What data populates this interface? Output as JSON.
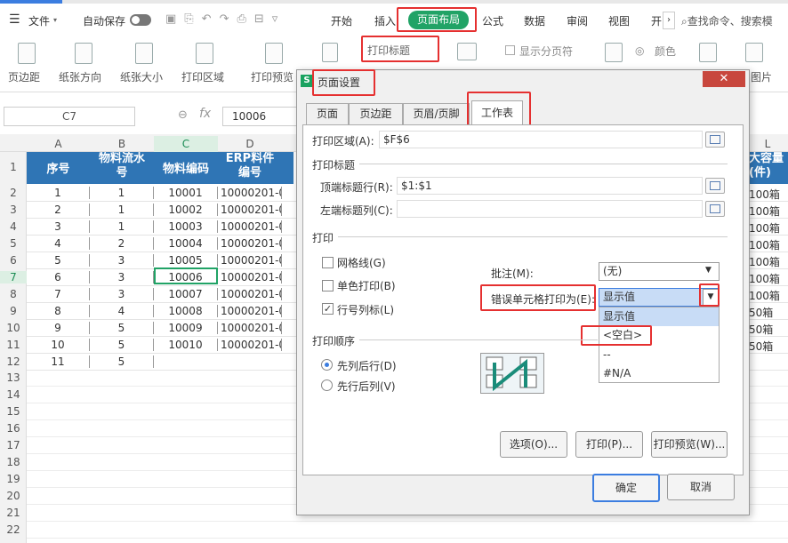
{
  "toolbar": {
    "file": "文件",
    "autosave": "自动保存",
    "search": "查找命令、搜索模"
  },
  "tabs": [
    "开始",
    "插入",
    "页面布局",
    "公式",
    "数据",
    "审阅",
    "视图",
    "开"
  ],
  "ribbon": {
    "margin": "页边距",
    "orientation": "纸张方向",
    "size": "纸张大小",
    "area": "打印区域",
    "preview": "打印预览",
    "print_title": "打印标题",
    "show_pagebreak": "显示分页符",
    "color": "颜色",
    "pic": "图片"
  },
  "namebox": "C7",
  "formula_value": "10006",
  "columns": [
    "A",
    "B",
    "C",
    "D",
    "L"
  ],
  "header": {
    "a": "序号",
    "b": "物料流水号",
    "c": "物料编码",
    "d": "ERP料件编号",
    "l": "大容量(件)"
  },
  "rows": [
    {
      "n": "2",
      "a": "1",
      "b": "1",
      "c": "10001",
      "d": "10000201-0",
      "l": "100箱"
    },
    {
      "n": "3",
      "a": "2",
      "b": "1",
      "c": "10002",
      "d": "10000201-0",
      "l": "100箱"
    },
    {
      "n": "4",
      "a": "3",
      "b": "1",
      "c": "10003",
      "d": "10000201-0",
      "l": "100箱"
    },
    {
      "n": "5",
      "a": "4",
      "b": "2",
      "c": "10004",
      "d": "10000201-0",
      "l": "100箱"
    },
    {
      "n": "6",
      "a": "5",
      "b": "3",
      "c": "10005",
      "d": "10000201-0",
      "l": "100箱"
    },
    {
      "n": "7",
      "a": "6",
      "b": "3",
      "c": "10006",
      "d": "10000201-0",
      "l": "100箱"
    },
    {
      "n": "8",
      "a": "7",
      "b": "3",
      "c": "10007",
      "d": "10000201-0",
      "l": "100箱"
    },
    {
      "n": "9",
      "a": "8",
      "b": "4",
      "c": "10008",
      "d": "10000201-0",
      "l": "50箱"
    },
    {
      "n": "10",
      "a": "9",
      "b": "5",
      "c": "10009",
      "d": "10000201-0",
      "l": "50箱"
    },
    {
      "n": "11",
      "a": "10",
      "b": "5",
      "c": "10010",
      "d": "10000201-0",
      "l": "50箱"
    },
    {
      "n": "12",
      "a": "11",
      "b": "5",
      "c": "",
      "d": "",
      "l": ""
    }
  ],
  "row1": "1",
  "extra_rows": [
    "13",
    "14",
    "15",
    "16",
    "17",
    "18",
    "19",
    "20",
    "21",
    "22"
  ],
  "dialog": {
    "title": "页面设置",
    "tabs": [
      "页面",
      "页边距",
      "页眉/页脚",
      "工作表"
    ],
    "print_area_label": "打印区域(A):",
    "print_area_value": "$F$6",
    "print_titles": "打印标题",
    "top_rows_label": "顶端标题行(R):",
    "top_rows_value": "$1:$1",
    "left_cols_label": "左端标题列(C):",
    "print_section": "打印",
    "gridlines": "网格线(G)",
    "mono": "单色打印(B)",
    "rowcol": "行号列标(L)",
    "comments_label": "批注(M):",
    "comments_value": "(无)",
    "errors_label": "错误单元格打印为(E):",
    "errors_value": "显示值",
    "options": [
      "显示值",
      "<空白>",
      "--",
      "#N/A"
    ],
    "order_section": "打印顺序",
    "down_then_over": "先列后行(D)",
    "over_then_down": "先行后列(V)",
    "btn_options": "选项(O)...",
    "btn_print": "打印(P)...",
    "btn_preview": "打印预览(W)...",
    "ok": "确定",
    "cancel": "取消"
  }
}
